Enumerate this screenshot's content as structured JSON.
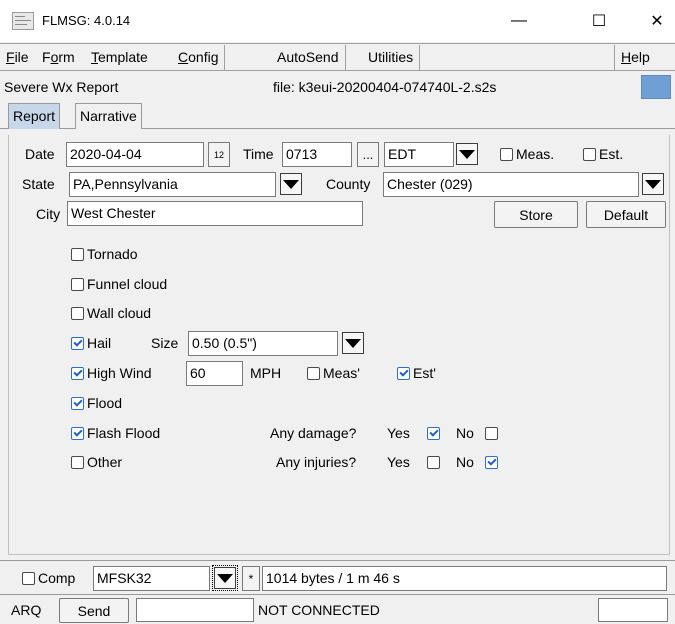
{
  "window": {
    "title": "FLMSG: 4.0.14",
    "minimize": "—",
    "maximize": "☐",
    "close": "✕"
  },
  "menu": {
    "file": "File",
    "form": "Form",
    "template": "Template",
    "config": "Config",
    "autosend": "AutoSend",
    "utilities": "Utilities",
    "help": "Help"
  },
  "header": {
    "form_name": "Severe Wx Report",
    "file": "file: k3eui-20200404-074740L-2.s2s",
    "indicator_color": "#6f9fd5"
  },
  "tabs": [
    {
      "label": "Report",
      "active": true
    },
    {
      "label": "Narrative",
      "active": false
    }
  ],
  "report": {
    "date_label": "Date",
    "date_value": "2020-04-04",
    "calendar_icon_text": "12",
    "time_label": "Time",
    "time_value": "0713",
    "time_button": "...",
    "timezone_value": "EDT",
    "meas_label": "Meas.",
    "est_label": "Est.",
    "meas_checked": false,
    "est_checked": false,
    "state_label": "State",
    "state_value": "PA,Pennsylvania",
    "county_label": "County",
    "county_value": "Chester  (029)",
    "city_label": "City",
    "city_value": "West Chester",
    "store_button": "Store",
    "default_button": "Default",
    "events": {
      "tornado": {
        "label": "Tornado",
        "checked": false
      },
      "funnel_cloud": {
        "label": "Funnel cloud",
        "checked": false
      },
      "wall_cloud": {
        "label": "Wall cloud",
        "checked": false
      },
      "hail": {
        "label": "Hail",
        "checked": true
      },
      "high_wind": {
        "label": "High Wind",
        "checked": true
      },
      "flood": {
        "label": "Flood",
        "checked": true
      },
      "flash_flood": {
        "label": "Flash Flood",
        "checked": true
      },
      "other": {
        "label": "Other",
        "checked": false
      }
    },
    "hail_size_label": "Size",
    "hail_size_value": "0.50 (0.5\")",
    "wind_value": "60",
    "wind_unit": "MPH",
    "wind_meas_label": "Meas'",
    "wind_est_label": "Est'",
    "wind_meas_checked": false,
    "wind_est_checked": true,
    "damage_label": "Any damage?",
    "damage_yes_label": "Yes",
    "damage_no_label": "No",
    "damage_yes_checked": true,
    "damage_no_checked": false,
    "injuries_label": "Any injuries?",
    "injuries_yes_label": "Yes",
    "injuries_no_label": "No",
    "injuries_yes_checked": false,
    "injuries_no_checked": true
  },
  "compression": {
    "comp_label": "Comp",
    "comp_checked": false,
    "mode_value": "MFSK32",
    "star_button": "*",
    "size_text": "1014 bytes / 1 m 46 s"
  },
  "status": {
    "arq_label": "ARQ",
    "send_button": "Send",
    "connection_text": "NOT CONNECTED"
  }
}
